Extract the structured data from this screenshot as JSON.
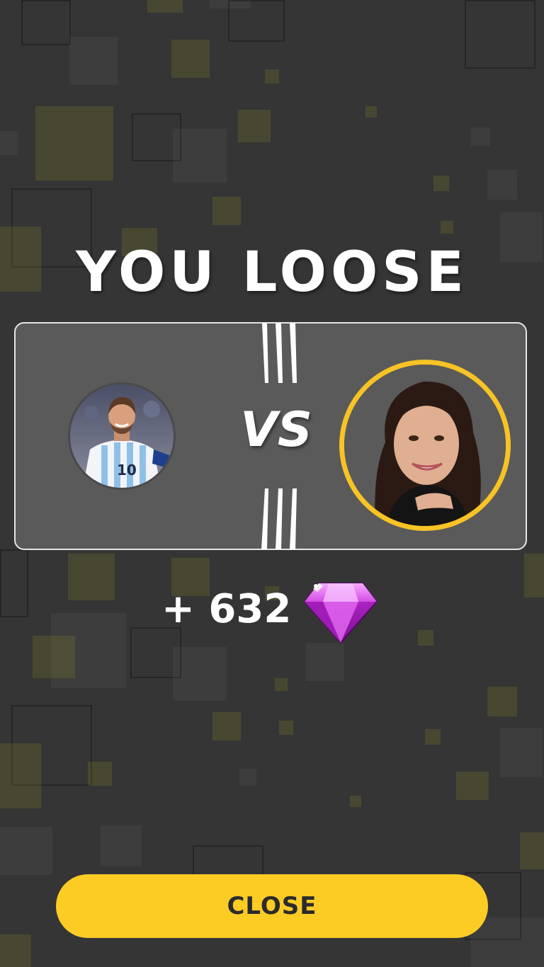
{
  "result": {
    "title": "YOU LOOSE"
  },
  "versus": {
    "vs_label": "VS"
  },
  "reward": {
    "text": "+ 632",
    "icon": "gem-icon"
  },
  "actions": {
    "close_label": "CLOSE"
  },
  "colors": {
    "background": "#353535",
    "accent_yellow": "#fccc25",
    "ring_yellow": "#f7c325",
    "gem_purple": "#c22bd6"
  }
}
